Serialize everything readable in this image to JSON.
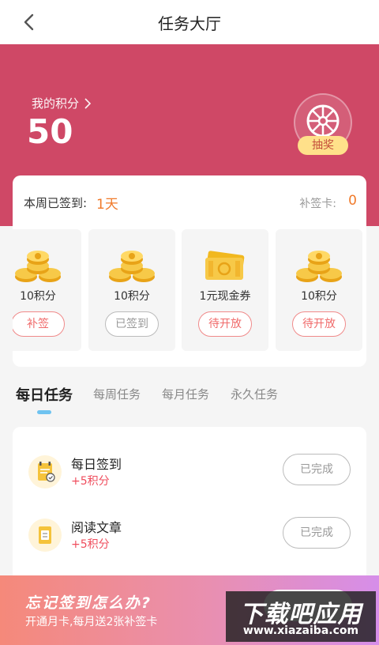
{
  "nav": {
    "title": "任务大厅",
    "back_icon": "back-arrow-icon"
  },
  "points": {
    "label": "我的积分",
    "value": "50",
    "chevron_icon": "chevron-right-icon"
  },
  "lottery": {
    "label": "抽奖",
    "icon": "wheel-icon"
  },
  "signin": {
    "week_label": "本周已签到:",
    "week_days": "1天",
    "makeup_label": "补签卡:",
    "makeup_count": "0",
    "days": [
      {
        "reward": "10积分",
        "button": "补签",
        "style": "red",
        "image": "gold-coins-icon"
      },
      {
        "reward": "10积分",
        "button": "已签到",
        "style": "gray",
        "image": "gold-coins-icon"
      },
      {
        "reward": "1元现金券",
        "button": "待开放",
        "style": "red",
        "image": "cash-coupon-icon"
      },
      {
        "reward": "10积分",
        "button": "待开放",
        "style": "red",
        "image": "gold-coins-icon"
      }
    ]
  },
  "tabs": [
    {
      "label": "每日任务",
      "active": true
    },
    {
      "label": "每周任务",
      "active": false
    },
    {
      "label": "每月任务",
      "active": false
    },
    {
      "label": "永久任务",
      "active": false
    }
  ],
  "tasks": [
    {
      "name": "每日签到",
      "points": "+5积分",
      "button": "已完成",
      "icon": "calendar-check-icon"
    },
    {
      "name": "阅读文章",
      "points": "+5积分",
      "button": "已完成",
      "icon": "document-icon"
    }
  ],
  "promo": {
    "title": "忘记签到怎么办?",
    "subtitle": "开通月卡,每月送2张补签卡"
  },
  "watermark": {
    "line1": "下载吧应用",
    "line2": "www.xiazaiba.com"
  },
  "colors": {
    "brand": "#cf4866",
    "accent_orange": "#f07a2a",
    "points_red": "#ef4d5d",
    "tab_indicator": "#6fc3f0"
  }
}
